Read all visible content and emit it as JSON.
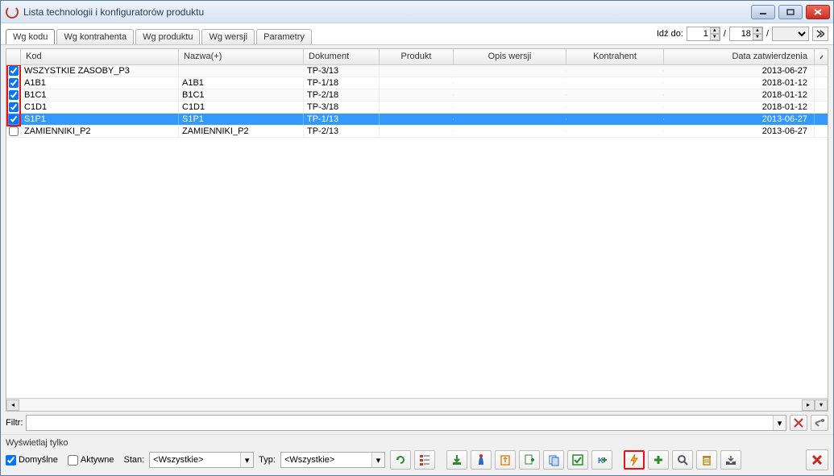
{
  "window": {
    "title": "Lista technologii i konfiguratorów produktu"
  },
  "tabs": [
    {
      "label": "Wg kodu",
      "active": true
    },
    {
      "label": "Wg kontrahenta",
      "active": false
    },
    {
      "label": "Wg produktu",
      "active": false
    },
    {
      "label": "Wg wersji",
      "active": false
    },
    {
      "label": "Parametry",
      "active": false
    }
  ],
  "goto": {
    "label": "Idź do:",
    "value1": "1",
    "value2": "18",
    "separator": "/"
  },
  "columns": {
    "kod": "Kod",
    "nazwa": "Nazwa(+)",
    "dokument": "Dokument",
    "produkt": "Produkt",
    "opis": "Opis wersji",
    "kontrahent": "Kontrahent",
    "data": "Data zatwierdzenia"
  },
  "rows": [
    {
      "checked": true,
      "kod": "WSZYSTKIE ZASOBY_P3",
      "nazwa": "",
      "dokument": "TP-3/13",
      "produkt": "",
      "opis": "",
      "kontrahent": "",
      "data": "2013-06-27",
      "selected": false
    },
    {
      "checked": true,
      "kod": "A1B1",
      "nazwa": "A1B1",
      "dokument": "TP-1/18",
      "produkt": "",
      "opis": "",
      "kontrahent": "",
      "data": "2018-01-12",
      "selected": false
    },
    {
      "checked": true,
      "kod": "B1C1",
      "nazwa": "B1C1",
      "dokument": "TP-2/18",
      "produkt": "",
      "opis": "",
      "kontrahent": "",
      "data": "2018-01-12",
      "selected": false
    },
    {
      "checked": true,
      "kod": "C1D1",
      "nazwa": "C1D1",
      "dokument": "TP-3/18",
      "produkt": "",
      "opis": "",
      "kontrahent": "",
      "data": "2018-01-12",
      "selected": false
    },
    {
      "checked": true,
      "kod": "S1P1",
      "nazwa": "S1P1",
      "dokument": "TP-1/13",
      "produkt": "",
      "opis": "",
      "kontrahent": "",
      "data": "2013-06-27",
      "selected": true
    },
    {
      "checked": false,
      "kod": "ZAMIENNIKI_P2",
      "nazwa": "ZAMIENNIKI_P2",
      "dokument": "TP-2/13",
      "produkt": "",
      "opis": "",
      "kontrahent": "",
      "data": "2013-06-27",
      "selected": false
    }
  ],
  "filter": {
    "label": "Filtr:",
    "value": ""
  },
  "display": {
    "groupLabel": "Wyświetlaj tylko",
    "domyslne": {
      "label": "Domyślne",
      "checked": true
    },
    "aktywne": {
      "label": "Aktywne",
      "checked": false
    }
  },
  "stan": {
    "label": "Stan:",
    "value": "<Wszystkie>"
  },
  "typ": {
    "label": "Typ:",
    "value": "<Wszystkie>"
  }
}
